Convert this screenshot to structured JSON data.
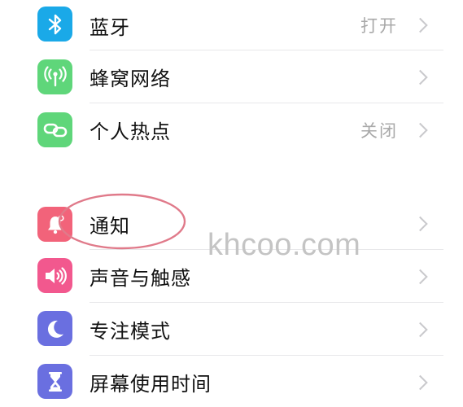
{
  "groups": [
    {
      "items": [
        {
          "label": "蓝牙",
          "value": "打开",
          "icon": "bluetooth-icon",
          "color": "#1aa9e8"
        },
        {
          "label": "蜂窝网络",
          "value": "",
          "icon": "cellular-antenna-icon",
          "color": "#5fd67a"
        },
        {
          "label": "个人热点",
          "value": "关闭",
          "icon": "hotspot-link-icon",
          "color": "#5fd67a"
        }
      ]
    },
    {
      "items": [
        {
          "label": "通知",
          "value": "",
          "icon": "notification-bell-icon",
          "color": "#f2637a"
        },
        {
          "label": "声音与触感",
          "value": "",
          "icon": "speaker-sound-icon",
          "color": "#f2588e"
        },
        {
          "label": "专注模式",
          "value": "",
          "icon": "moon-focus-icon",
          "color": "#6a6fe0"
        },
        {
          "label": "屏幕使用时间",
          "value": "",
          "icon": "hourglass-icon",
          "color": "#6a6fe0"
        }
      ]
    }
  ],
  "annotation": {
    "color": "#e07a8a"
  },
  "watermark": {
    "text": "khcoo.com"
  }
}
